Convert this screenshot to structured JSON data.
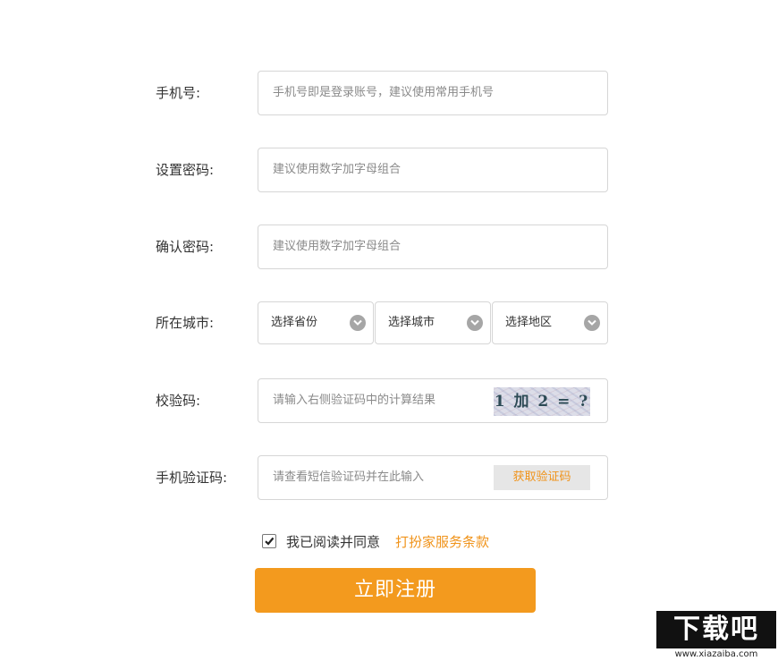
{
  "form": {
    "phone": {
      "label": "手机号:",
      "placeholder": "手机号即是登录账号，建议使用常用手机号",
      "value": ""
    },
    "password": {
      "label": "设置密码:",
      "placeholder": "建议使用数字加字母组合",
      "value": ""
    },
    "confirm_password": {
      "label": "确认密码:",
      "placeholder": "建议使用数字加字母组合",
      "value": ""
    },
    "city": {
      "label": "所在城市:",
      "province_selected": "选择省份",
      "city_selected": "选择城市",
      "district_selected": "选择地区"
    },
    "captcha": {
      "label": "校验码:",
      "placeholder": "请输入右侧验证码中的计算结果",
      "value": "",
      "image_text": "1 加 2 = ?"
    },
    "sms_code": {
      "label": "手机验证码:",
      "placeholder": "请查看短信验证码并在此输入",
      "value": "",
      "button_label": "获取验证码"
    },
    "agreement": {
      "checked": true,
      "text": "我已阅读并同意",
      "link_text": "打扮家服务条款"
    },
    "submit_label": "立即注册"
  },
  "watermark": {
    "logo_text": "下载吧",
    "url": "www.xiazaiba.com"
  },
  "colors": {
    "accent": "#f39a1e",
    "link": "#f0931a",
    "border": "#d6d6d6",
    "label_text": "#333333",
    "placeholder": "#8a8a8a"
  },
  "icons": {
    "select_arrow": "chevron-down-icon",
    "checkbox": "checkmark-icon"
  }
}
